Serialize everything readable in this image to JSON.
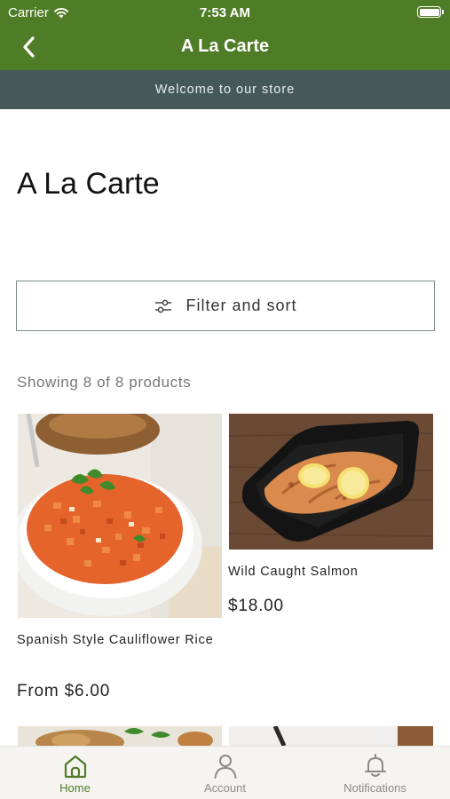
{
  "status_bar": {
    "carrier": "Carrier",
    "time": "7:53 AM"
  },
  "nav": {
    "title": "A La Carte"
  },
  "banner": {
    "text": "Welcome to our store"
  },
  "page": {
    "title": "A La Carte"
  },
  "filter": {
    "label": "Filter and sort"
  },
  "results": {
    "count_text": "Showing 8 of 8 products"
  },
  "products": [
    {
      "name": "Spanish Style Cauliflower Rice",
      "price": "From $6.00"
    },
    {
      "name": "Wild Caught Salmon",
      "price": "$18.00"
    }
  ],
  "tabs": [
    {
      "label": "Home",
      "icon": "home-icon",
      "active": true
    },
    {
      "label": "Account",
      "icon": "account-icon",
      "active": false
    },
    {
      "label": "Notifications",
      "icon": "bell-icon",
      "active": false
    }
  ],
  "colors": {
    "brand_green": "#4f7c26",
    "banner_slate": "#45595a"
  }
}
